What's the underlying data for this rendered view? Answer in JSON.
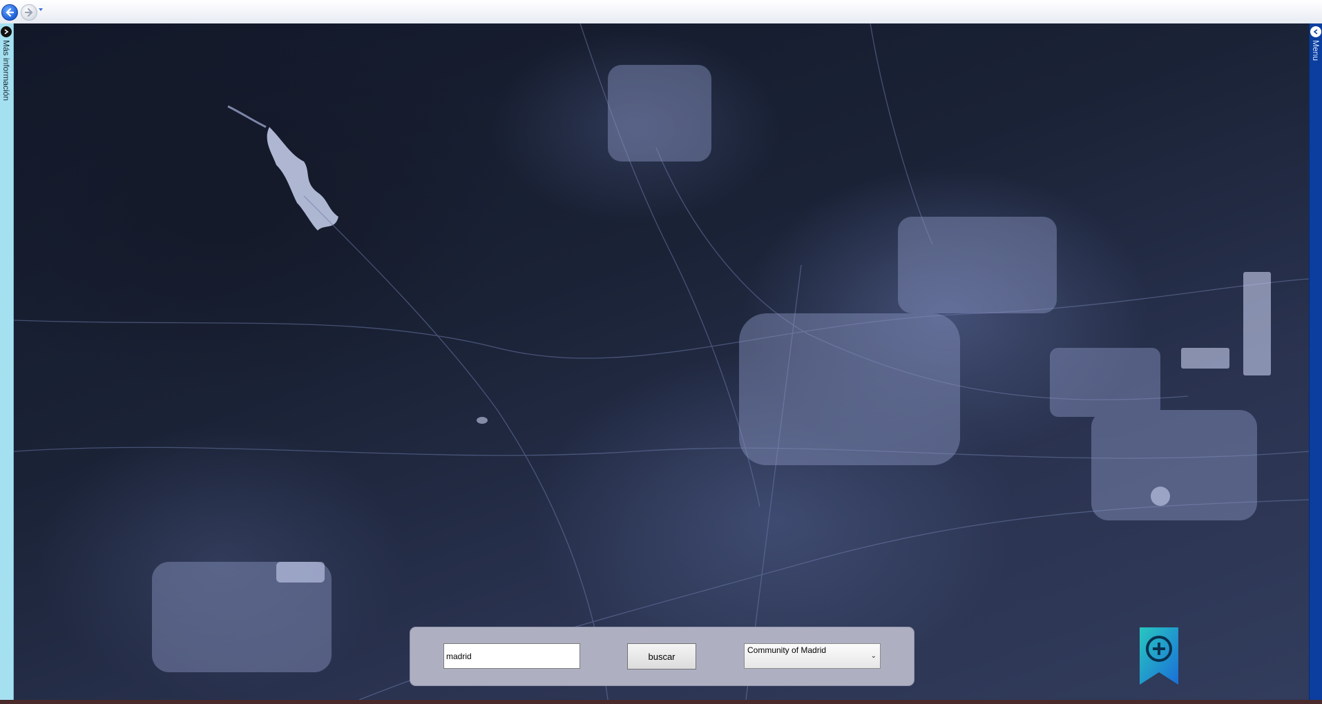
{
  "nav": {
    "back_icon": "back-arrow-icon",
    "forward_icon": "forward-arrow-icon",
    "dropdown_icon": "history-dropdown-icon"
  },
  "left_panel": {
    "label": "Más información",
    "toggle_icon": "chevron-right-icon"
  },
  "right_panel": {
    "label": "Menu",
    "toggle_icon": "chevron-left-icon"
  },
  "map": {
    "kind": "satellite imagery"
  },
  "search": {
    "query_value": "madrid",
    "button_label": "buscar",
    "region_selected": "Community of Madrid"
  },
  "bookmark": {
    "icon": "add-bookmark-icon",
    "color": "#1aa0d8"
  }
}
